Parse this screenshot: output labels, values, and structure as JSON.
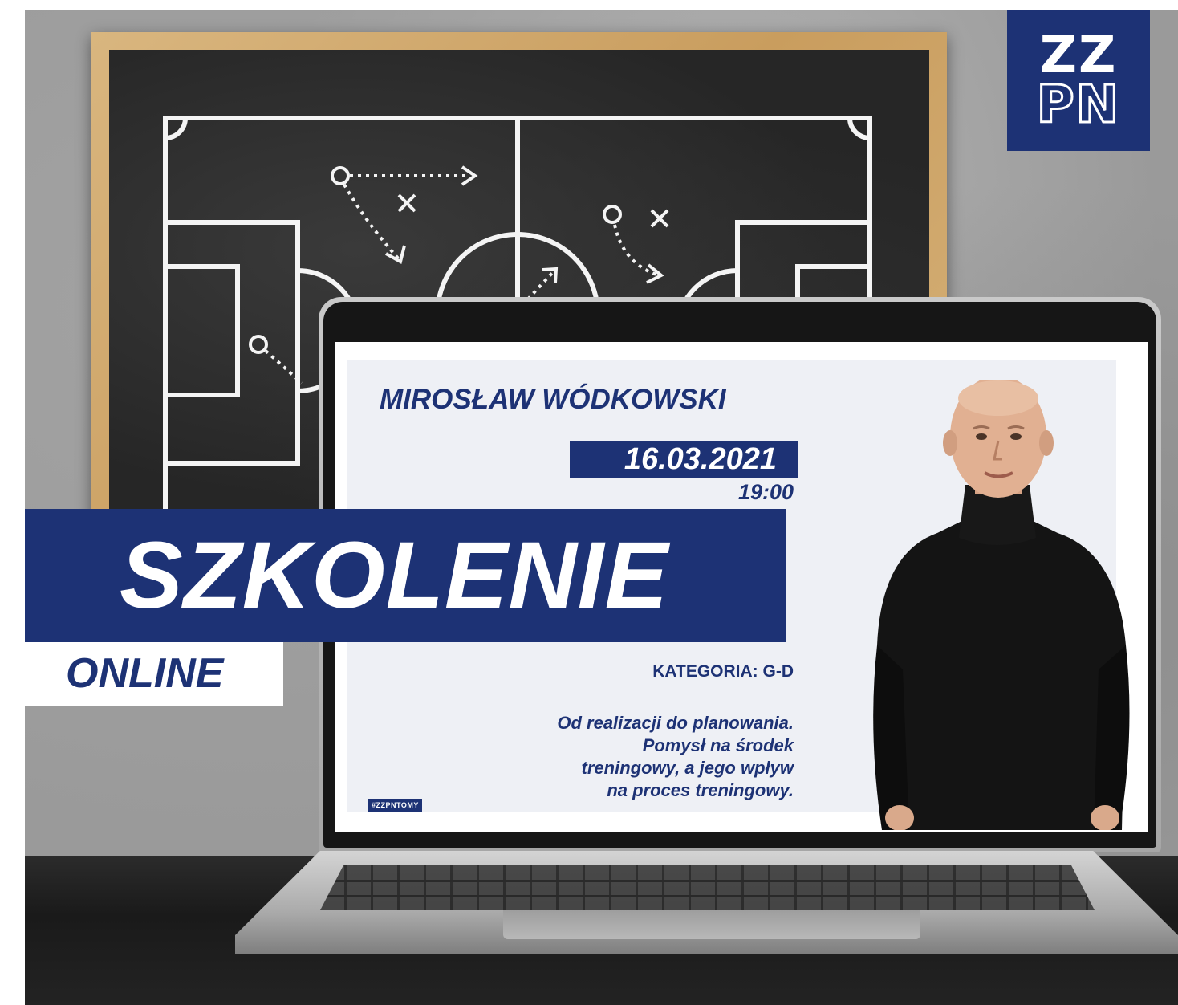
{
  "logo": {
    "line1": "ZZ",
    "line2": "PN",
    "icon": "zzpn-logo"
  },
  "board": {
    "icon": "tactics-chalkboard-icon"
  },
  "screen": {
    "speaker_name": "MIROSŁAW WÓDKOWSKI",
    "date": "16.03.2021",
    "time": "19:00",
    "category": "KATEGORIA: G-D",
    "description_lines": [
      "Od realizacji do planowania.",
      "Pomysł na środek",
      "treningowy, a jego wpływ",
      "na proces treningowy."
    ],
    "hashtag": "#ZZPNTOMY"
  },
  "banner": {
    "title": "SZKOLENIE",
    "subtitle": "ONLINE"
  },
  "colors": {
    "brand_navy": "#1d3275",
    "white": "#ffffff"
  }
}
